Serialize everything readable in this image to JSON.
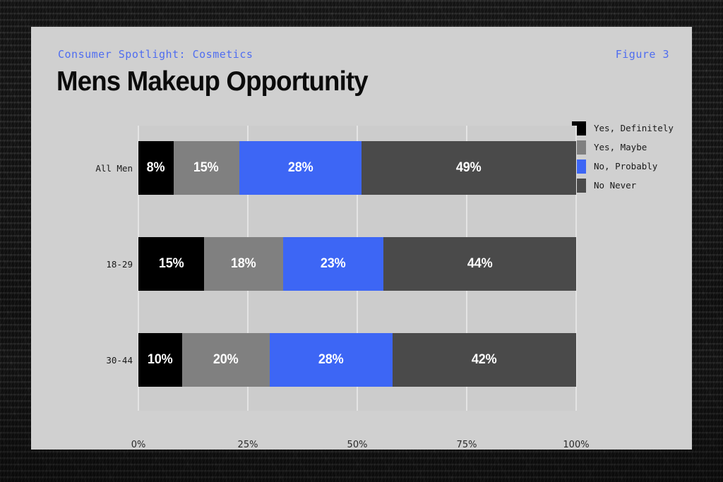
{
  "card": {
    "eyebrow": "Consumer Spotlight: Cosmetics",
    "figure_label": "Figure 3",
    "title": "Mens Makeup Opportunity"
  },
  "colors": {
    "accent_blue": "#4f6df0",
    "series_yes_definitely": "#000000",
    "series_yes_maybe": "#808080",
    "series_no_probably": "#3d66f5",
    "series_no_never": "#4a4a4a",
    "card_background": "#d0d0d0",
    "plot_band": "#cccccc",
    "gridline": "#e4e4e4"
  },
  "legend": {
    "items": [
      {
        "label": "Yes, Definitely",
        "color": "#000000"
      },
      {
        "label": "Yes, Maybe",
        "color": "#808080"
      },
      {
        "label": "No, Probably",
        "color": "#3d66f5"
      },
      {
        "label": "No Never",
        "color": "#4a4a4a"
      }
    ]
  },
  "chart_data": {
    "type": "bar",
    "orientation": "horizontal",
    "stacked": true,
    "title": "Mens Makeup Opportunity",
    "subtitle": "Consumer Spotlight: Cosmetics",
    "xlabel": "",
    "ylabel": "",
    "xlim": [
      0,
      100
    ],
    "grid": true,
    "legend_position": "top-right",
    "categories": [
      "All Men",
      "18-29",
      "30-44"
    ],
    "tick_labels": [
      "0%",
      "25%",
      "50%",
      "75%",
      "100%"
    ],
    "tick_values": [
      0,
      25,
      50,
      75,
      100
    ],
    "series": [
      {
        "name": "Yes, Definitely",
        "color": "#000000",
        "values": [
          8,
          15,
          10
        ],
        "labels": [
          "8%",
          "15%",
          "10%"
        ]
      },
      {
        "name": "Yes, Maybe",
        "color": "#808080",
        "values": [
          15,
          18,
          20
        ],
        "labels": [
          "15%",
          "18%",
          "20%"
        ]
      },
      {
        "name": "No, Probably",
        "color": "#3d66f5",
        "values": [
          28,
          23,
          28
        ],
        "labels": [
          "28%",
          "23%",
          "28%"
        ]
      },
      {
        "name": "No Never",
        "color": "#4a4a4a",
        "values": [
          49,
          44,
          42
        ],
        "labels": [
          "49%",
          "44%",
          "42%"
        ]
      }
    ]
  }
}
